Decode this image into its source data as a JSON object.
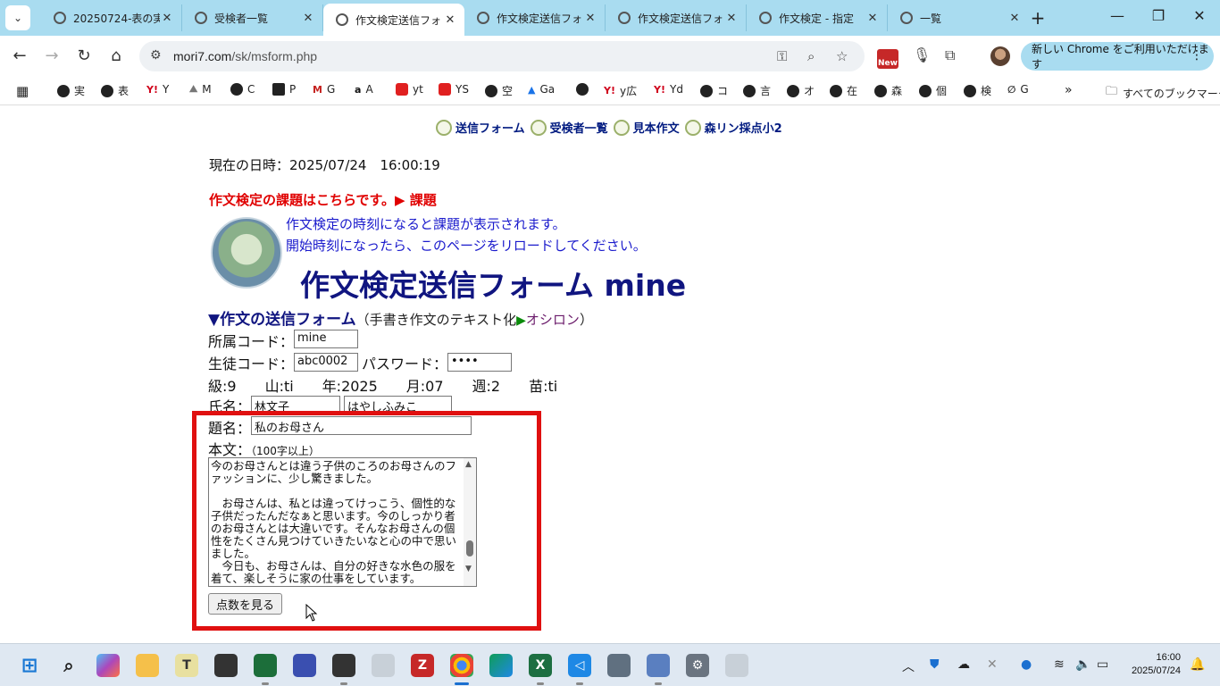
{
  "browser": {
    "tabs": [
      {
        "title": "20250724-表の実",
        "active": false
      },
      {
        "title": "受検者一覧",
        "active": false
      },
      {
        "title": "作文検定送信フォ",
        "active": true
      },
      {
        "title": "作文検定送信フォ",
        "active": false
      },
      {
        "title": "作文検定送信フォ",
        "active": false
      },
      {
        "title": "作文検定 - 指定",
        "active": false
      },
      {
        "title": "一覧",
        "active": false
      }
    ],
    "url_host": "mori7.com",
    "url_path": "/sk/msform.php",
    "new_badge": "New",
    "update_prompt": "新しい Chrome をご利用いただけます",
    "bookmarks": [
      "実",
      "表",
      "Y",
      "M",
      "C",
      "P",
      "G",
      "A",
      "yt",
      "YS",
      "空",
      "Ga",
      "",
      "y広",
      "Yd",
      "コ",
      "言",
      "オ",
      "在",
      "森",
      "個",
      "検",
      "G"
    ],
    "all_bookmarks": "すべてのブックマーク"
  },
  "page": {
    "nav": [
      "送信フォーム",
      "受検者一覧",
      "見本作文",
      "森リン採点小2"
    ],
    "datetime": "現在の日時：2025/07/24　16:00:19",
    "task_notice": "作文検定の課題はこちらです。▶ 課題",
    "notice_line1": "作文検定の時刻になると課題が表示されます。",
    "notice_line2": "開始時刻になったら、このページをリロードしてください。",
    "title": "作文検定送信フォーム mine",
    "section_title": "▼作文の送信フォーム",
    "section_sub": "（手書き作文のテキスト化",
    "section_arrow": "▶",
    "section_link": "オシロン",
    "section_close": "）",
    "labels": {
      "affiliation": "所属コード：",
      "student": "生徒コード：",
      "password": "パスワード：",
      "name": "氏名：",
      "subject": "題名：",
      "body": "本文：",
      "body_note": "（100字以上）"
    },
    "values": {
      "affiliation": "mine",
      "student": "abc0002",
      "password": "••••",
      "name_kanji": "林文子",
      "name_kana": "はやしふみこ",
      "subject": "私のお母さん"
    },
    "info_line": "級:9　　山:ti　　年:2025　　月:07　　週:2　　苗:ti",
    "essay_text": "今のお母さんとは違う子供のころのお母さんのファッションに、少し驚きました。\n\n　お母さんは、私とは違ってけっこう、個性的な子供だったんだなぁと思います。今のしっかり者のお母さんとは大違いです。そんなお母さんの個性をたくさん見つけていきたいなと心の中で思いました。\n　今日も、お母さんは、自分の好きな水色の服を着て、楽しそうに家の仕事をしています。",
    "score_button": "点数を見る"
  },
  "taskbar": {
    "time": "16:00",
    "date": "2025/07/24"
  },
  "colors": {
    "tabstrip": "#a9dcf0",
    "highlight": "#e01010",
    "title": "#101580",
    "task": "#e00000",
    "notice": "#1a1acc"
  }
}
